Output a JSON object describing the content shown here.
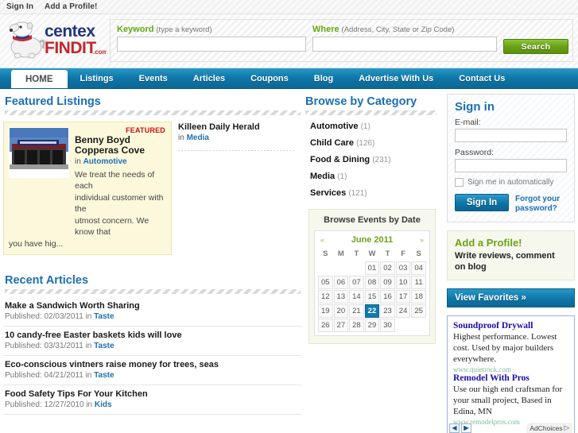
{
  "topbar": {
    "signin": "Sign In",
    "addprofile": "Add a Profile!"
  },
  "logo": {
    "brand_top": "centex",
    "brand_bottom": "FINDIT",
    "brand_tld": ".com"
  },
  "search": {
    "keyword_label": "Keyword",
    "keyword_hint": "(type a keyword)",
    "keyword_value": "",
    "where_label": "Where",
    "where_hint": "(Address, City, State or Zip Code)",
    "where_value": "",
    "button": "Search"
  },
  "nav": {
    "items": [
      {
        "label": "HOME",
        "active": true
      },
      {
        "label": "Listings",
        "active": false
      },
      {
        "label": "Events",
        "active": false
      },
      {
        "label": "Articles",
        "active": false
      },
      {
        "label": "Coupons",
        "active": false
      },
      {
        "label": "Blog",
        "active": false
      },
      {
        "label": "Advertise With Us",
        "active": false
      },
      {
        "label": "Contact Us",
        "active": false
      }
    ]
  },
  "featured": {
    "heading": "Featured Listings",
    "badge": "FEATURED",
    "primary": {
      "title": "Benny Boyd Copperas Cove",
      "in_word": "in",
      "category": "Automotive",
      "desc_line1": "We treat the needs of each",
      "desc_line2": "individual customer with the",
      "desc_line3": "utmost concern. We know that",
      "desc_line4": "you have hig..."
    },
    "secondary": {
      "title": "Killeen Daily Herald",
      "in_word": "in",
      "category": "Media"
    }
  },
  "articles": {
    "heading": "Recent Articles",
    "published_word": "Published:",
    "in_word": "in",
    "items": [
      {
        "title": "Make a Sandwich Worth Sharing",
        "date": "02/03/2011",
        "category": "Taste"
      },
      {
        "title": "10 candy-free Easter baskets kids will love",
        "date": "03/31/2011",
        "category": "Taste"
      },
      {
        "title": "Eco-conscious vintners raise money for trees, seas",
        "date": "04/21/2011",
        "category": "Taste"
      },
      {
        "title": "Food Safety Tips For Your Kitchen",
        "date": "12/27/2010",
        "category": "Kids"
      }
    ]
  },
  "categories": {
    "heading": "Browse by Category",
    "items": [
      {
        "label": "Automotive",
        "count": "(1)"
      },
      {
        "label": "Child Care",
        "count": "(126)"
      },
      {
        "label": "Food & Dining",
        "count": "(231)"
      },
      {
        "label": "Media",
        "count": "(1)"
      },
      {
        "label": "Services",
        "count": "(121)"
      }
    ]
  },
  "calendar": {
    "title": "Browse Events by Date",
    "month": "June 2011",
    "prev": "«",
    "next": "»",
    "daynames": [
      "S",
      "M",
      "T",
      "W",
      "T",
      "F",
      "S"
    ],
    "weeks": [
      [
        "",
        "",
        "",
        "01",
        "02",
        "03",
        "04"
      ],
      [
        "05",
        "06",
        "07",
        "08",
        "09",
        "10",
        "11"
      ],
      [
        "12",
        "13",
        "14",
        "15",
        "16",
        "17",
        "18"
      ],
      [
        "19",
        "20",
        "21",
        "22",
        "23",
        "24",
        "25"
      ],
      [
        "26",
        "27",
        "28",
        "29",
        "30",
        "",
        ""
      ]
    ],
    "selected": "22"
  },
  "signin_panel": {
    "heading": "Sign in",
    "email_label": "E-mail:",
    "email_value": "",
    "password_label": "Password:",
    "password_value": "",
    "auto_label": "Sign me in automatically",
    "button": "Sign In",
    "forgot_line1": "Forgot your",
    "forgot_line2": "password?"
  },
  "add_profile": {
    "heading": "Add a Profile!",
    "desc": "Write reviews, comment on blog"
  },
  "favorites": {
    "label": "View Favorites »"
  },
  "ads": {
    "items": [
      {
        "title": "Soundproof Drywall",
        "body": "Highest performance. Lowest cost. Used by major builders everywhere.",
        "url": "www.quietrock.com"
      },
      {
        "title": "Remodel With Pros",
        "body": "Use our high end craftsman for your small project, Based in Edina, MN",
        "url": "www.remodelpros.com"
      }
    ],
    "prev_icon": "◀",
    "next_icon": "▶",
    "adchoices": "AdChoices",
    "adchoices_icon": "▷"
  },
  "colors": {
    "accent_blue": "#1b6fb5",
    "nav_blue": "#0f76a8",
    "green": "#6aa316",
    "featured_red": "#cc1111",
    "featured_bg": "#fcf8db"
  }
}
